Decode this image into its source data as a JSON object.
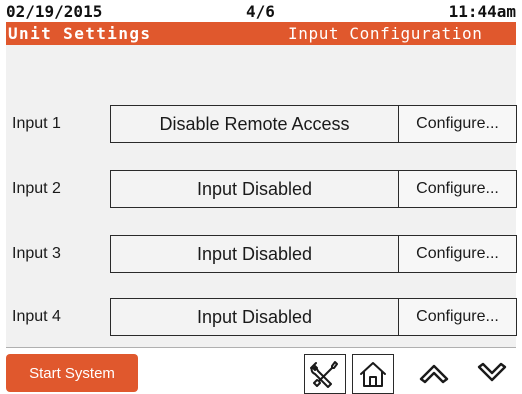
{
  "status": {
    "date": "02/19/2015",
    "page": "4/6",
    "time": "11:44am"
  },
  "title": {
    "section": "Unit Settings",
    "page": "Input Configuration"
  },
  "inputs": [
    {
      "label": "Input 1",
      "mode": "Disable Remote Access",
      "configure": "Configure..."
    },
    {
      "label": "Input 2",
      "mode": "Input Disabled",
      "configure": "Configure..."
    },
    {
      "label": "Input 3",
      "mode": "Input Disabled",
      "configure": "Configure..."
    },
    {
      "label": "Input 4",
      "mode": "Input Disabled",
      "configure": "Configure..."
    }
  ],
  "bottom": {
    "start_label": "Start System",
    "icons": [
      "tools-icon",
      "home-icon",
      "chevron-up-icon",
      "chevron-down-icon"
    ]
  },
  "colors": {
    "accent": "#e0582d",
    "panel": "#f1f1f1",
    "border": "#2a2a2a"
  }
}
